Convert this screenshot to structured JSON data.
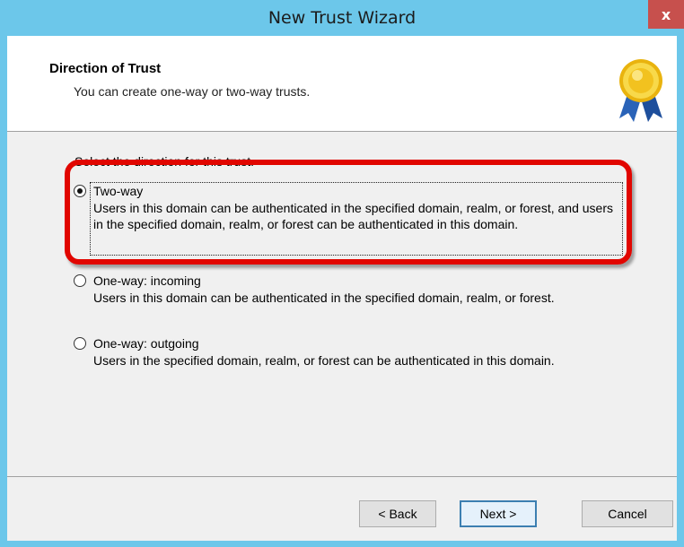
{
  "window": {
    "title": "New Trust Wizard",
    "close_label": "x"
  },
  "header": {
    "title": "Direction of Trust",
    "subtitle": "You can create one-way or two-way trusts.",
    "icon": "award-ribbon-icon"
  },
  "content": {
    "prompt": "Select the direction for this trust.",
    "options": [
      {
        "label": "Two-way",
        "description": "Users in this domain can be authenticated in the specified domain, realm, or forest, and users in the specified domain, realm, or forest can be authenticated in this domain.",
        "selected": true
      },
      {
        "label": "One-way: incoming",
        "description": "Users in this domain can be authenticated in the specified domain, realm, or forest.",
        "selected": false
      },
      {
        "label": "One-way: outgoing",
        "description": "Users in the specified domain, realm, or forest can be authenticated in this domain.",
        "selected": false
      }
    ]
  },
  "buttons": {
    "back": "< Back",
    "next": "Next >",
    "cancel": "Cancel"
  },
  "colors": {
    "title_bar": "#6cc7ea",
    "close_button": "#c7504d",
    "highlight": "#e10600"
  }
}
